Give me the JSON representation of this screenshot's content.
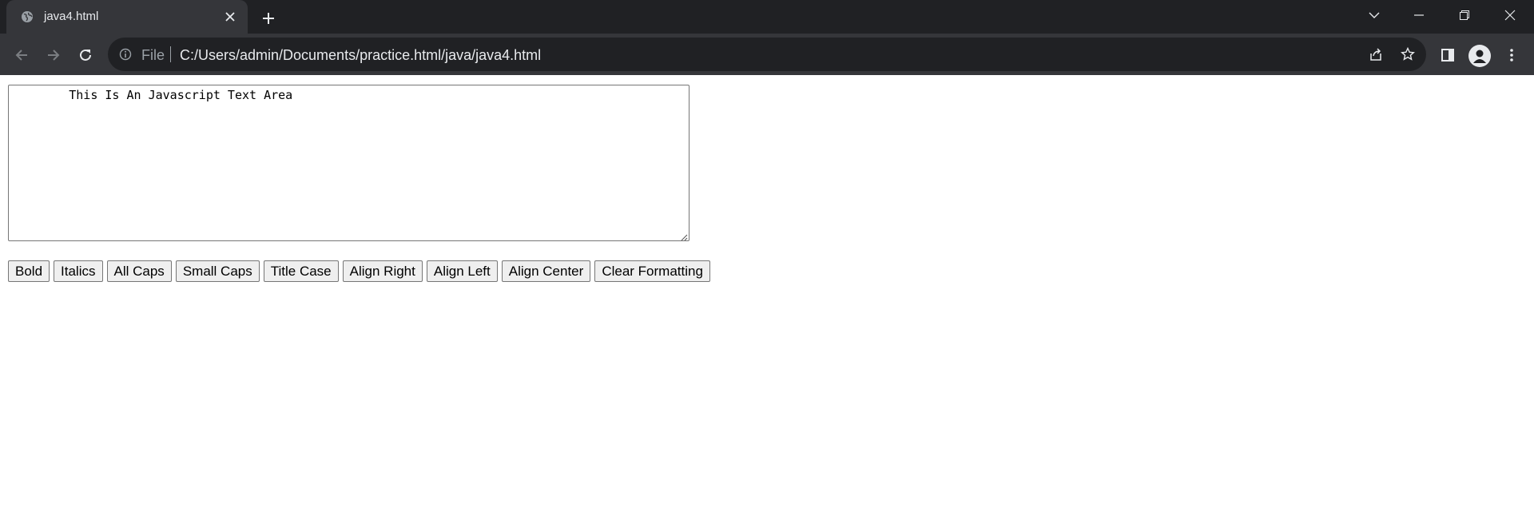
{
  "browser": {
    "tab": {
      "title": "java4.html",
      "favicon": "globe-icon",
      "close_icon": "close-icon"
    },
    "new_tab_icon": "plus-icon",
    "window_controls": [
      "chevron-down-icon",
      "minimize-icon",
      "restore-icon",
      "close-icon"
    ],
    "toolbar": {
      "back_icon": "arrow-left-icon",
      "forward_icon": "arrow-right-icon",
      "reload_icon": "reload-icon",
      "scheme": "File",
      "url": "C:/Users/admin/Documents/practice.html/java/java4.html",
      "share_icon": "share-icon",
      "bookmark_icon": "star-icon",
      "side_panel_icon": "side-panel-icon",
      "profile_icon": "avatar",
      "menu_icon": "kebab-menu-icon"
    },
    "colors": {
      "tabstrip": "#202124",
      "toolbar": "#35363a",
      "omnibox": "#202124",
      "text": "#e8eaed"
    }
  },
  "page": {
    "textarea": {
      "value": "        This Is An Javascript Text Area"
    },
    "buttons": [
      {
        "label": "Bold"
      },
      {
        "label": "Italics"
      },
      {
        "label": "All Caps"
      },
      {
        "label": "Small Caps"
      },
      {
        "label": "Title Case"
      },
      {
        "label": "Align Right"
      },
      {
        "label": "Align Left"
      },
      {
        "label": "Align Center"
      },
      {
        "label": "Clear Formatting"
      }
    ]
  }
}
